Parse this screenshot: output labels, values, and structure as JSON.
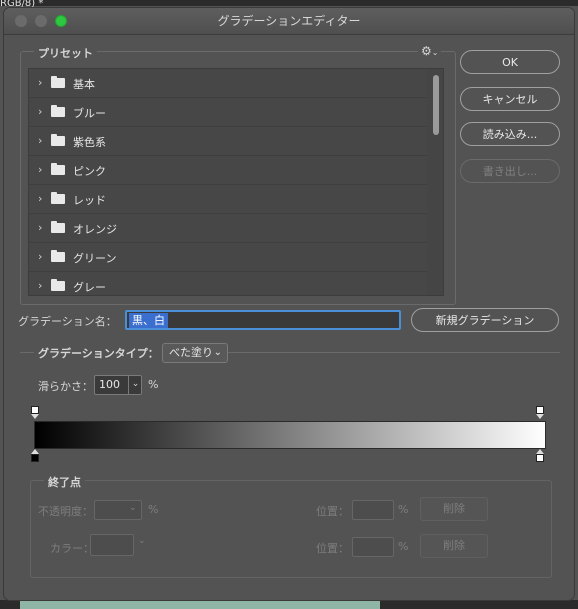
{
  "background": {
    "tab_text": "RGB/8) *"
  },
  "window": {
    "title": "グラデーションエディター"
  },
  "presets": {
    "label": "プリセット",
    "gear_icon": "⚙",
    "items": [
      {
        "label": "基本"
      },
      {
        "label": "ブルー"
      },
      {
        "label": "紫色系"
      },
      {
        "label": "ピンク"
      },
      {
        "label": "レッド"
      },
      {
        "label": "オレンジ"
      },
      {
        "label": "グリーン"
      },
      {
        "label": "グレー"
      }
    ]
  },
  "buttons": {
    "ok": "OK",
    "cancel": "キャンセル",
    "load": "読み込み...",
    "save": "書き出し...",
    "new_gradient": "新規グラデーション"
  },
  "name": {
    "label": "グラデーション名：",
    "value": "黒、白"
  },
  "gradient_type": {
    "label": "グラデーションタイプ：",
    "selected": "べた塗り"
  },
  "smoothness": {
    "label": "滑らかさ：",
    "value": "100",
    "unit": "%"
  },
  "gradient": {
    "start_color": "#000000",
    "end_color": "#ffffff"
  },
  "stops": {
    "label": "終了点",
    "opacity_label": "不透明度：",
    "opacity_unit": "%",
    "color_label": "カラー：",
    "location_label_1": "位置：",
    "location_unit_1": "%",
    "delete_1": "削除",
    "location_label_2": "位置：",
    "location_unit_2": "%",
    "delete_2": "削除"
  }
}
